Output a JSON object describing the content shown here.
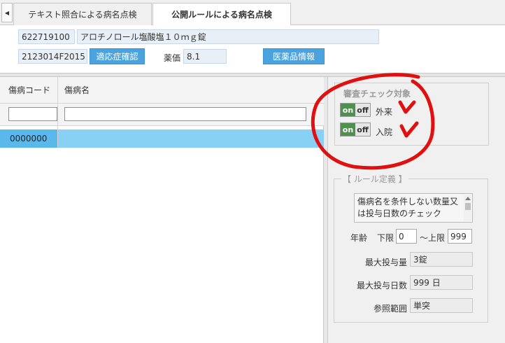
{
  "tabs": [
    {
      "label": "テキスト照合による病名点検"
    },
    {
      "label": "公開ルールによる病名点検"
    }
  ],
  "drug": {
    "code": "622719100",
    "name": "アロチノロール塩酸塩１０ｍｇ錠",
    "yj_code": "2123014F2015",
    "indication_button": "適応症確認",
    "price_label": "薬価",
    "price": "8.1",
    "info_button": "医薬品情報"
  },
  "grid": {
    "columns": [
      "傷病コード",
      "傷病名"
    ],
    "rows": [
      {
        "code": "0000000",
        "name": ""
      }
    ]
  },
  "check_target": {
    "title": "審査チェック対象",
    "items": [
      {
        "on": "on",
        "off": "off",
        "label": "外来"
      },
      {
        "on": "on",
        "off": "off",
        "label": "入院"
      }
    ]
  },
  "rule": {
    "title": "【 ルール定義 】",
    "description": "傷病名を条件しない数量又は投与日数のチェック",
    "age_label": "年齢",
    "lower_label": "下限",
    "lower_value": "0",
    "upper_label": "～上限",
    "upper_value": "999",
    "max_qty_label": "最大投与量",
    "max_qty": "3錠",
    "max_days_label": "最大投与日数",
    "max_days": "999 日",
    "ref_label": "参照範囲",
    "ref_value": "単突"
  },
  "colors": {
    "accent_blue": "#4aa3df",
    "selected_row": "#89d0f5",
    "toggle_on": "#4f8f4f",
    "annotation_red": "#e01010"
  }
}
